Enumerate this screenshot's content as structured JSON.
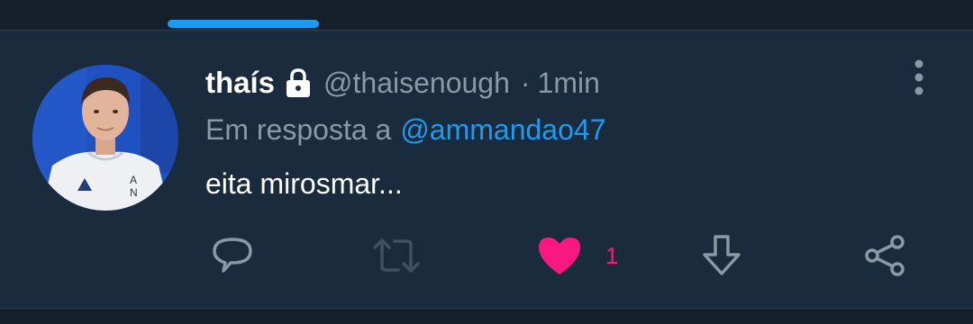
{
  "tweet": {
    "display_name": "thaís",
    "handle": "@thaisenough",
    "separator": "·",
    "time": "1min",
    "reply_prefix": "Em resposta a",
    "reply_to": "@ammandao47",
    "text": "eita mirosmar...",
    "protected": true
  },
  "actions": {
    "reply_icon": "reply-icon",
    "retweet_icon": "retweet-icon",
    "like_icon": "heart-icon",
    "like_count": "1",
    "liked": true,
    "download_icon": "download-icon",
    "share_icon": "share-icon"
  },
  "icons": {
    "more": "more-vertical-icon",
    "lock": "lock-icon"
  },
  "colors": {
    "background": "#192b3d",
    "accent": "#1d9bf0",
    "like": "#f91880",
    "muted": "#8b98a5",
    "text": "#ffffff"
  }
}
